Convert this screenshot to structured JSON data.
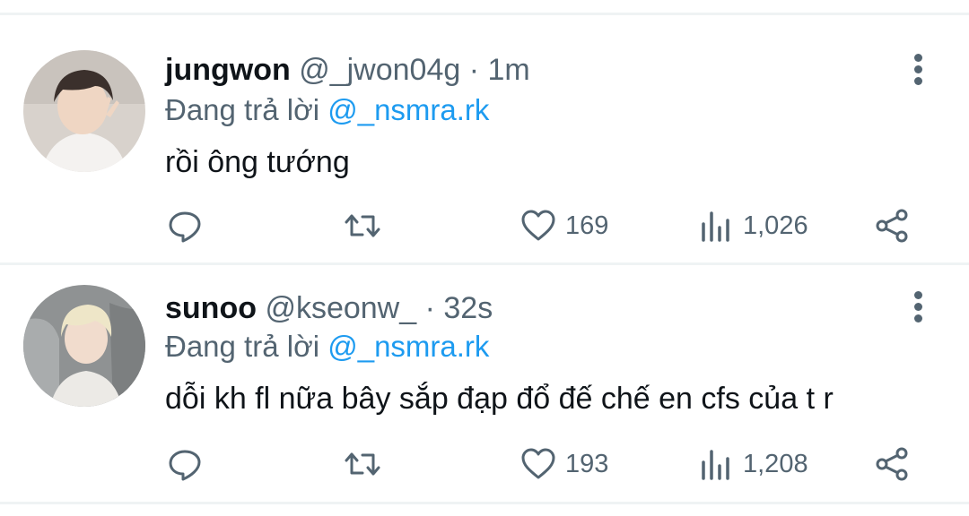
{
  "tweets": [
    {
      "display_name": "jungwon",
      "handle": "@_jwon04g",
      "separator": "·",
      "time": "1m",
      "replying_prefix": "Đang trả lời",
      "replying_to": "@_nsmra.rk",
      "text": "rồi ông tướng",
      "likes": "169",
      "views": "1,026",
      "avatar_icon": "profile-photo"
    },
    {
      "display_name": "sunoo",
      "handle": "@kseonw_",
      "separator": "·",
      "time": "32s",
      "replying_prefix": "Đang trả lời",
      "replying_to": "@_nsmra.rk",
      "text": "dỗi kh fl nữa bây sắp đạp đổ đế chế en cfs của t r",
      "likes": "193",
      "views": "1,208",
      "avatar_icon": "profile-photo"
    }
  ],
  "icons": {
    "reply": "reply-icon",
    "retweet": "retweet-icon",
    "like": "heart-icon",
    "views": "views-icon",
    "share": "share-icon",
    "more": "more-vertical-icon"
  },
  "colors": {
    "text": "#0f1419",
    "muted": "#536471",
    "mention": "#1d9bf0",
    "divider": "#eff3f4"
  }
}
